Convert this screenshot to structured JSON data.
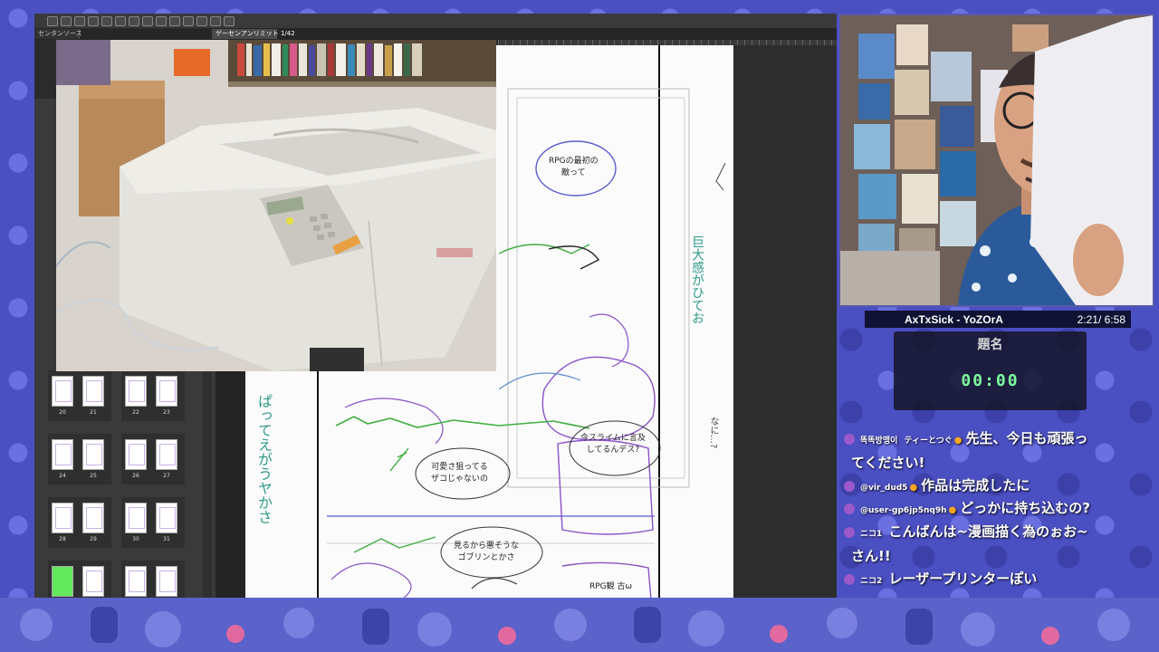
{
  "app": {
    "tabs": [
      {
        "label": "センタンソース",
        "active": false
      },
      {
        "label": "ゲーセンアンリミット 1/42",
        "active": true
      }
    ],
    "pages": [
      {
        "left": "20",
        "right": "21"
      },
      {
        "left": "22",
        "right": "23"
      },
      {
        "left": "24",
        "right": "25"
      },
      {
        "left": "26",
        "right": "27"
      },
      {
        "left": "28",
        "right": "29"
      },
      {
        "left": "30",
        "right": "31"
      }
    ]
  },
  "manga_page": {
    "bubbles": [
      {
        "line1": "RPGの最初の",
        "line2": "敵って"
      },
      {
        "line1": "今スライムに言及",
        "line2": "してるんデス?"
      },
      {
        "line1": "可愛さ狙ってる",
        "line2": "ザコじゃないの"
      },
      {
        "line1": "見るから悪そうな",
        "line2": "ゴブリンとかさ"
      },
      {
        "line1": "RPG観 古ω",
        "line2": ""
      }
    ],
    "vertical_notes": [
      "巨大感がひてお",
      "なに…?",
      "ぱってえがうヤかさ"
    ]
  },
  "split": {
    "title": "AxTxSick - YoZOrA",
    "time": "2:21/ 6:58",
    "label": "題名",
    "timer": "00:00"
  },
  "chat": {
    "lines": [
      {
        "user": "똑똑방맹이",
        "user2": "ティーとつぐ",
        "text": "先生、今日も頑張っ",
        "cont": "てください!"
      },
      {
        "user": "@vir_dud5",
        "text": "作品は完成したに"
      },
      {
        "user": "@user-gp6jp5nq9h",
        "text": "どっかに持ち込むの?"
      },
      {
        "user": "ニコ1",
        "text": "こんばんは~漫画描く為のぉお~",
        "cont": "さん!!"
      },
      {
        "user": "ニコ2",
        "text": "レーザープリンターぽい"
      }
    ]
  },
  "colors": {
    "background": "#4a4fc2",
    "chat_text": "#ffffff",
    "timer": "#7dff9c",
    "sketch_purple": "#8a52c8",
    "sketch_green": "#3fae3f",
    "sketch_teal": "#2f9a8a"
  }
}
